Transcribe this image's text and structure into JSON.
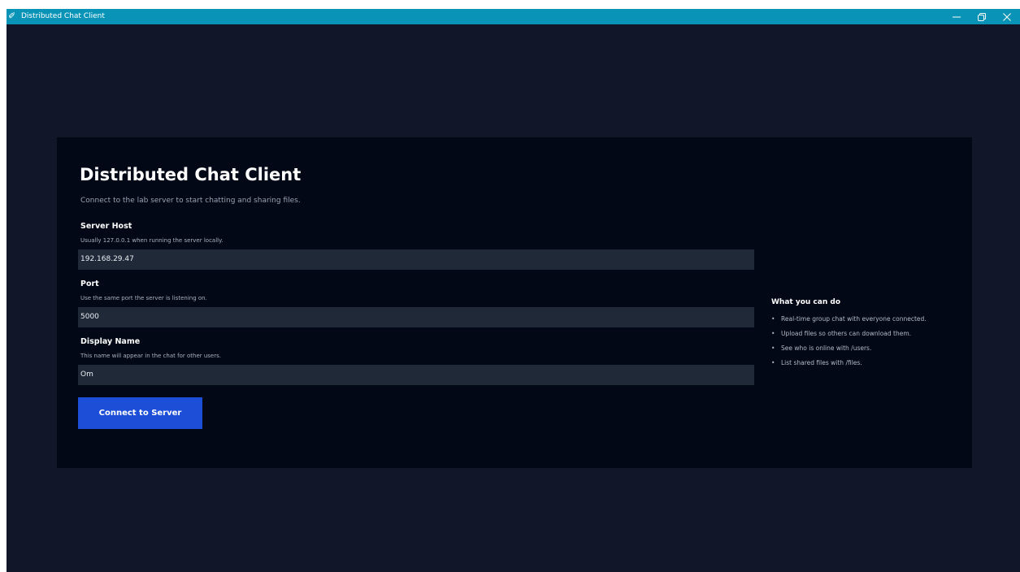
{
  "window": {
    "title": "Distributed Chat Client",
    "app_icon": "feather-icon",
    "controls": {
      "minimize": "minimize-icon",
      "restore": "restore-icon",
      "close": "close-icon"
    }
  },
  "form": {
    "heading": "Distributed Chat Client",
    "subtitle": "Connect to the lab server to start chatting and sharing files.",
    "host": {
      "label": "Server Host",
      "help": "Usually 127.0.0.1 when running the server locally.",
      "value": "192.168.29.47"
    },
    "port": {
      "label": "Port",
      "help": "Use the same port the server is listening on.",
      "value": "5000"
    },
    "name": {
      "label": "Display Name",
      "help": "This name will appear in the chat for other users.",
      "value": "Om"
    },
    "connect_label": "Connect to Server"
  },
  "info": {
    "title": "What you can do",
    "items": [
      "Real-time group chat with everyone connected.",
      "Upload files so others can download them.",
      "See who is online with /users.",
      "List shared files with /files."
    ]
  },
  "colors": {
    "titlebar": "#0994b7",
    "background": "#111729",
    "card": "#020816",
    "input": "#1f2937",
    "accent": "#1d4ed8"
  }
}
